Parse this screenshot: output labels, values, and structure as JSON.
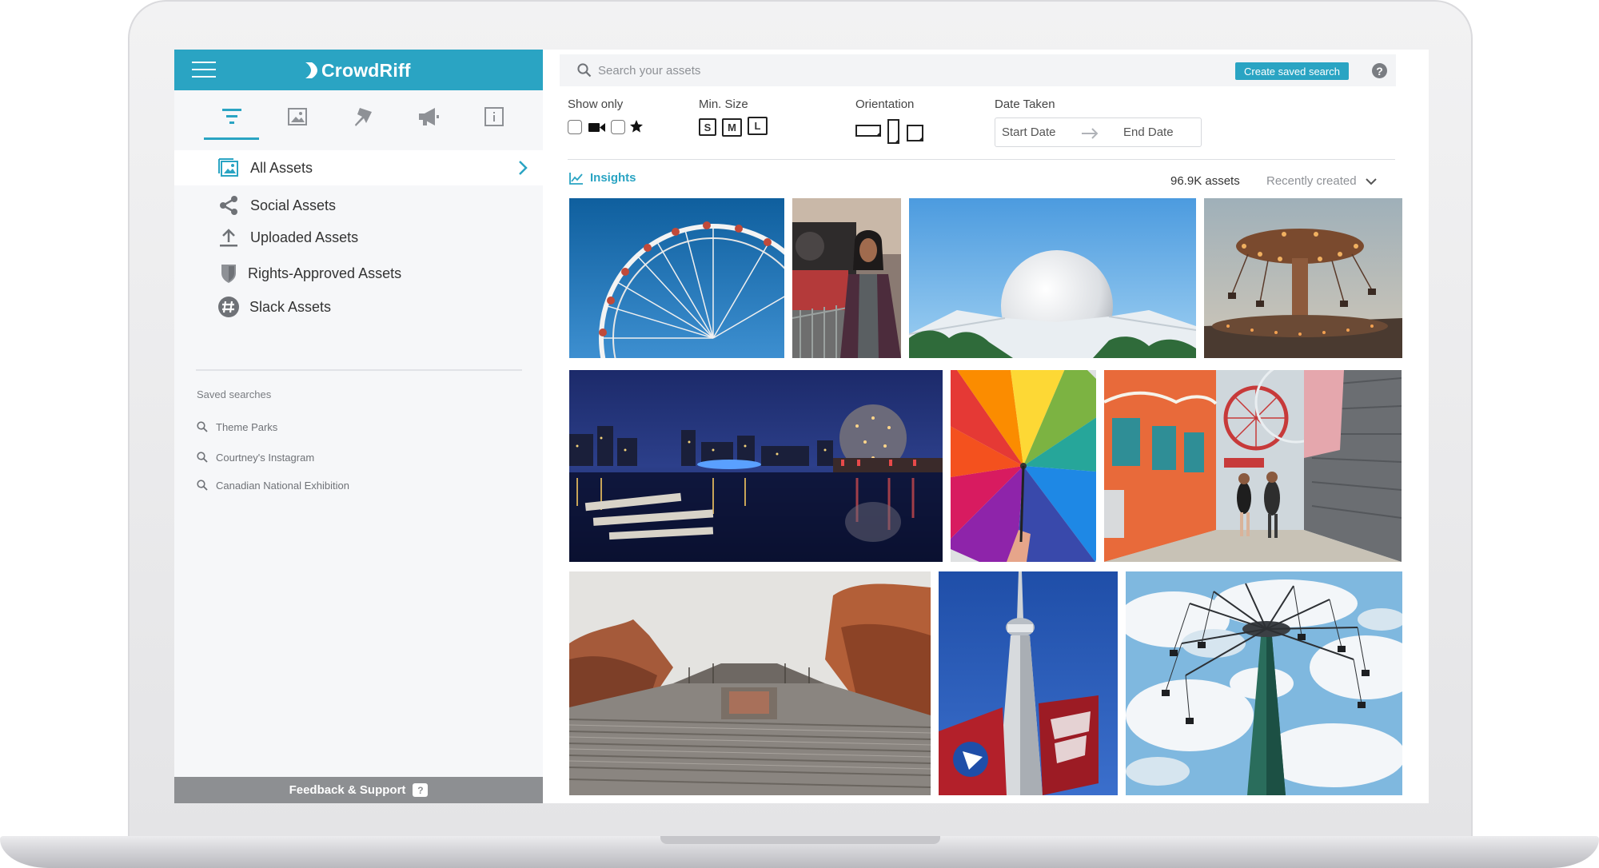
{
  "brand": {
    "name": "CrowdRiff",
    "color": "#2aa4c3"
  },
  "sidebar": {
    "tabs": [
      {
        "icon": "filter-icon"
      },
      {
        "icon": "gallery-icon"
      },
      {
        "icon": "pin-icon"
      },
      {
        "icon": "megaphone-icon"
      },
      {
        "icon": "info-icon"
      }
    ],
    "nav": [
      {
        "label": "All Assets",
        "icon": "all-assets-icon",
        "active": true
      },
      {
        "label": "Social Assets",
        "icon": "share-icon"
      },
      {
        "label": "Uploaded Assets",
        "icon": "upload-icon"
      },
      {
        "label": "Rights-Approved Assets",
        "icon": "shield-icon"
      },
      {
        "label": "Slack Assets",
        "icon": "slack-icon"
      }
    ],
    "saved_title": "Saved searches",
    "saved": [
      {
        "label": "Theme Parks"
      },
      {
        "label": "Courtney's Instagram"
      },
      {
        "label": "Canadian National Exhibition"
      }
    ],
    "feedback": {
      "label": "Feedback & Support",
      "badge": "?"
    }
  },
  "search": {
    "placeholder": "Search your assets",
    "value": "",
    "create_saved_label": "Create saved search",
    "help_label": "?"
  },
  "filters": {
    "show_only": {
      "label": "Show only",
      "video_checked": false,
      "favorites_checked": false
    },
    "min_size": {
      "label": "Min. Size",
      "options": [
        "S",
        "M",
        "L"
      ]
    },
    "orientation": {
      "label": "Orientation",
      "options": [
        "landscape",
        "portrait",
        "square"
      ]
    },
    "date_taken": {
      "label": "Date Taken",
      "start": "Start Date",
      "end": "End Date"
    }
  },
  "results": {
    "insights_label": "Insights",
    "count": "96.9K assets",
    "sort": "Recently created"
  },
  "assets": [
    {
      "name": "ferris-wheel-photo"
    },
    {
      "name": "woman-train-photo"
    },
    {
      "name": "geodesic-sphere-photo"
    },
    {
      "name": "swing-ride-dusk-photo"
    },
    {
      "name": "harbor-night-photo"
    },
    {
      "name": "rainbow-umbrella-photo"
    },
    {
      "name": "boardwalk-photo"
    },
    {
      "name": "amphitheatre-photo"
    },
    {
      "name": "tower-banner-photo"
    },
    {
      "name": "swing-tower-photo"
    }
  ]
}
